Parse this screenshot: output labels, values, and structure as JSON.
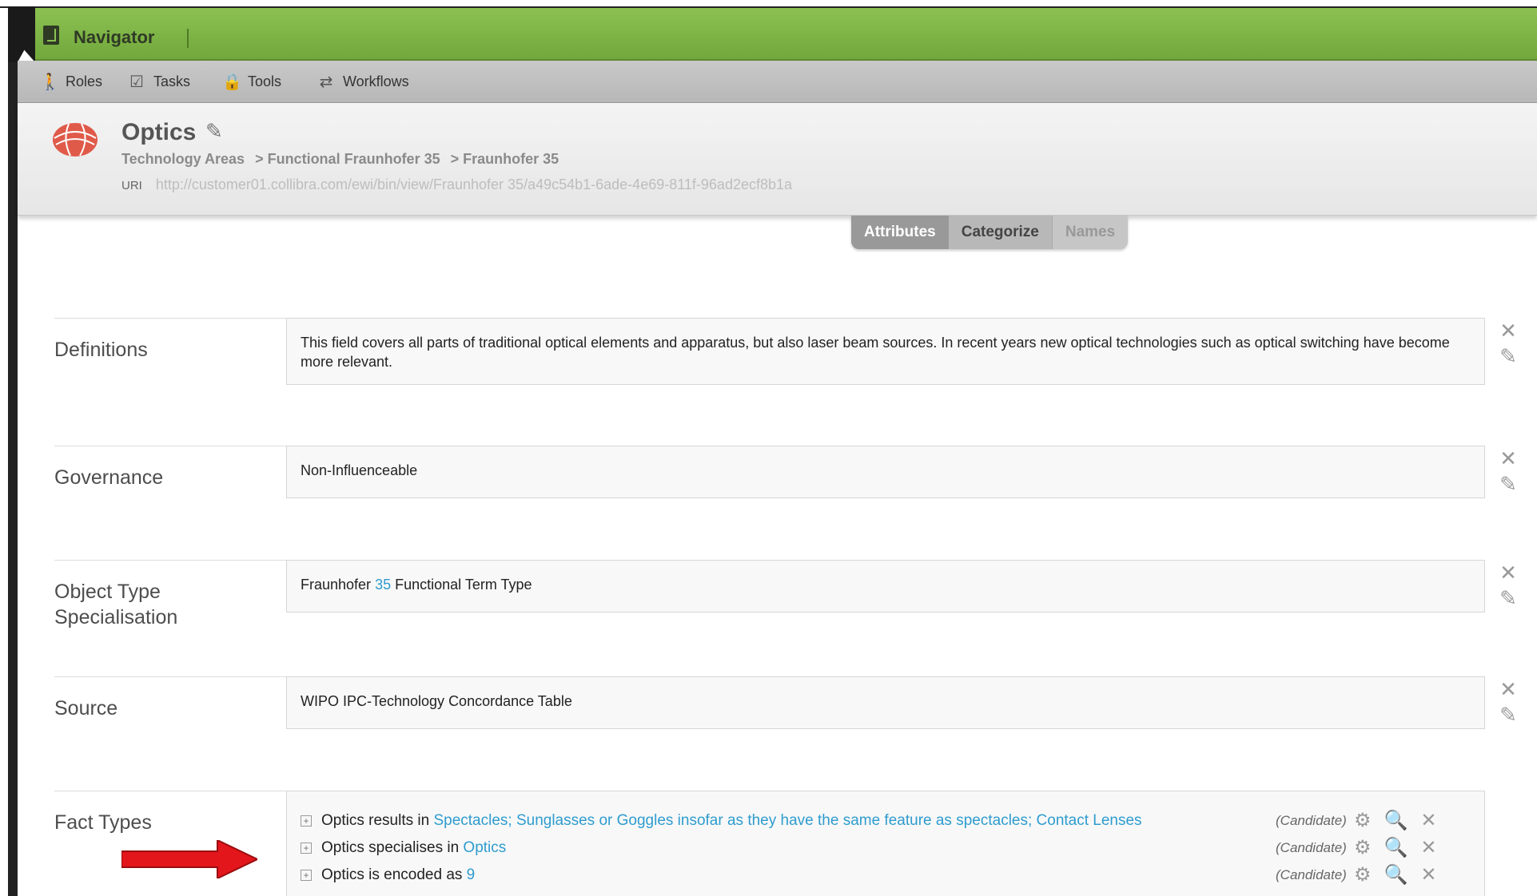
{
  "app": {
    "title": "Navigator"
  },
  "nav": [
    {
      "label": "Roles",
      "icon": "person-icon"
    },
    {
      "label": "Tasks",
      "icon": "checkbox-icon"
    },
    {
      "label": "Tools",
      "icon": "lock-icon"
    },
    {
      "label": "Workflows",
      "icon": "swap-arrows-icon"
    }
  ],
  "asset": {
    "title": "Optics",
    "breadcrumb": [
      "Technology Areas",
      "> Functional Fraunhofer 35",
      "> Fraunhofer 35"
    ],
    "uri_label": "URI",
    "uri": "http://customer01.collibra.com/ewi/bin/view/Fraunhofer 35/a49c54b1-6ade-4e69-811f-96ad2ecf8b1a"
  },
  "tabs": {
    "attributes": "Attributes",
    "categorize": "Categorize",
    "names": "Names"
  },
  "attributes": {
    "definitions": {
      "label": "Definitions",
      "value": "This field covers all parts of traditional optical elements and apparatus, but also laser beam sources. In recent years new optical technologies such as optical switching have become more relevant."
    },
    "governance": {
      "label": "Governance",
      "value": "Non-Influenceable"
    },
    "object_type": {
      "label": "Object Type Specialisation",
      "value_prefix": "Fraunhofer",
      "value_link": "35",
      "value_suffix": "Functional Term Type"
    },
    "source": {
      "label": "Source",
      "value": "WIPO IPC-Technology Concordance Table"
    }
  },
  "fact_types": {
    "label": "Fact Types",
    "items": [
      {
        "subject": "Optics",
        "relation": "results in",
        "object": "Spectacles; Sunglasses or Goggles insofar as they have the same feature as spectacles; Contact Lenses",
        "status": "(Candidate)"
      },
      {
        "subject": "Optics",
        "relation": "specialises in",
        "object": "Optics",
        "status": "(Candidate)"
      },
      {
        "subject": "Optics",
        "relation": "is encoded as",
        "object": "9",
        "status": "(Candidate)"
      }
    ]
  },
  "colors": {
    "topbar": "#8cc152",
    "link": "#2e9ccf",
    "arrow": "#e3161b"
  }
}
